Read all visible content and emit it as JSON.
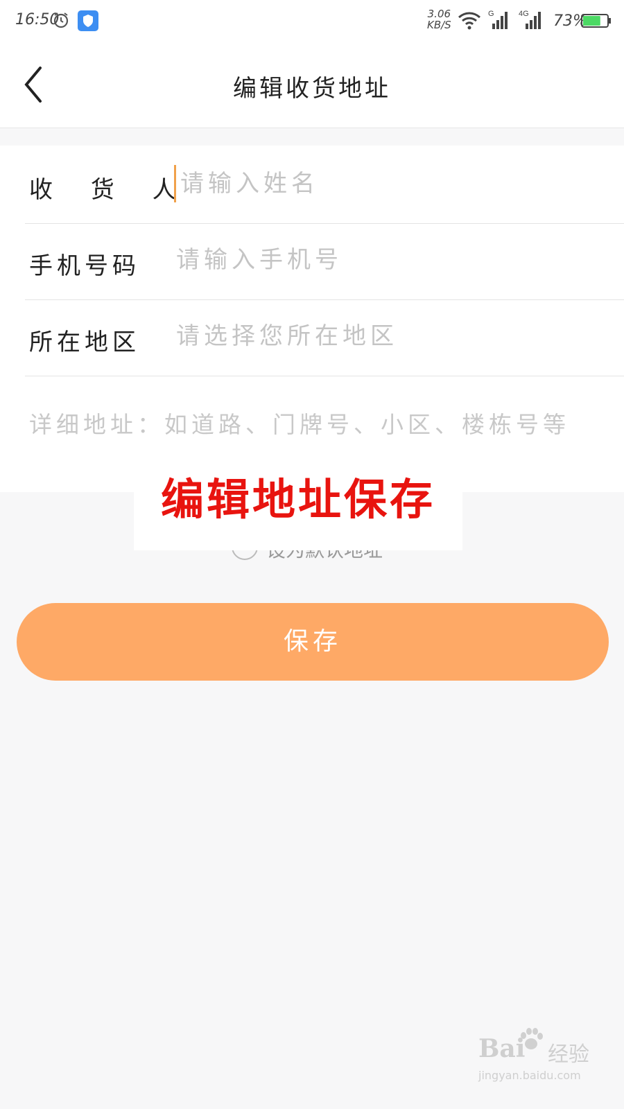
{
  "status_bar": {
    "time": "16:50",
    "speed_value": "3.06",
    "speed_unit": "KB/S",
    "battery_percent": "73%",
    "network_g": "G",
    "network_4g": "4G",
    "battery_level": 0.73,
    "icons": [
      "alarm-icon",
      "shield-icon",
      "wifi-icon",
      "signal-icon",
      "battery-icon"
    ]
  },
  "nav": {
    "title": "编辑收货地址",
    "back_icon": "chevron-left-icon"
  },
  "form": {
    "receiver_label": "收 货 人",
    "receiver_placeholder": "请输入姓名",
    "phone_label": "手机号码",
    "phone_placeholder": "请输入手机号",
    "region_label": "所在地区",
    "region_placeholder": "请选择您所在地区",
    "detail_placeholder": "详细地址：如道路、门牌号、小区、楼栋号等"
  },
  "default_option": {
    "label": "设为默认地址"
  },
  "overlay_caption": "编辑地址保存",
  "save_button": "保存",
  "watermark": {
    "brand": "Bai",
    "brand2": "经验",
    "url": "jingyan.baidu.com"
  },
  "colors": {
    "accent": "#fea966",
    "caption": "#e8140f",
    "cursor": "#f0a14a"
  }
}
